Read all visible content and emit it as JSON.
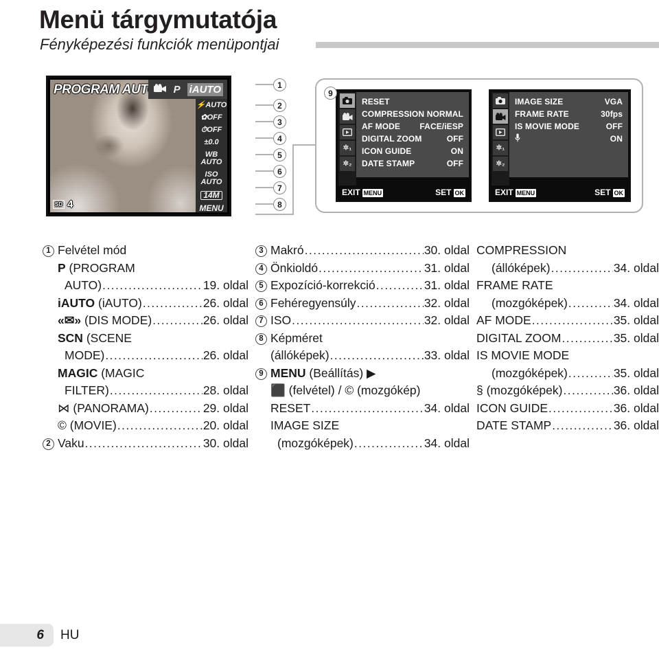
{
  "page": {
    "title": "Menü tárgymutatója",
    "subtitle": "Fényképezési funkciók menüpontjai",
    "footer_page_number": "6",
    "footer_language": "HU"
  },
  "lcd_preview": {
    "mode_banner": "PROGRAM AUTO",
    "topbar": [
      {
        "icon": "movie-icon",
        "label": "©©"
      },
      {
        "icon": "program-p-icon",
        "label": "P"
      },
      {
        "icon": "iauto-icon",
        "label": "iAUTO",
        "active": true
      }
    ],
    "side_items": [
      {
        "icon": "flash-icon",
        "label": "AUTO",
        "callout": "2"
      },
      {
        "icon": "macro-icon",
        "label": "OFF",
        "callout": "3"
      },
      {
        "icon": "selftimer-icon",
        "label": "OFF",
        "callout": "4"
      },
      {
        "icon": "exposure-comp-icon",
        "label": "±0.0",
        "callout": "5"
      },
      {
        "icon": "white-balance-icon",
        "label": "WB\nAUTO",
        "callout": "6"
      },
      {
        "icon": "iso-icon",
        "label": "ISO\nAUTO",
        "callout": "7"
      },
      {
        "icon": "image-size-icon",
        "label": "14M",
        "callout": "8"
      },
      {
        "icon": "menu-icon",
        "label": "MENU",
        "callout": ""
      }
    ],
    "card_label": "SD",
    "shots_remaining": "4",
    "callout_top": "1"
  },
  "menu_screens": {
    "group_callout": "9",
    "screens": [
      {
        "name": "shooting-menu",
        "selected_tab": 0,
        "tabs": [
          "camera-icon",
          "movie-icon",
          "playback-icon",
          "wrench-1-icon",
          "wrench-2-icon"
        ],
        "rows": [
          {
            "label": "RESET",
            "value": ""
          },
          {
            "label": "COMPRESSION",
            "value": "NORMAL"
          },
          {
            "label": "AF MODE",
            "value": "FACE/iESP"
          },
          {
            "label": "DIGITAL ZOOM",
            "value": "OFF"
          },
          {
            "label": "ICON GUIDE",
            "value": "ON"
          },
          {
            "label": "DATE STAMP",
            "value": "OFF"
          }
        ],
        "exit_label": "EXIT",
        "exit_key": "MENU",
        "set_label": "SET",
        "set_key": "OK"
      },
      {
        "name": "movie-menu",
        "selected_tab": 1,
        "tabs": [
          "camera-icon",
          "movie-icon",
          "playback-icon",
          "wrench-1-icon",
          "wrench-2-icon"
        ],
        "rows": [
          {
            "label": "IMAGE SIZE",
            "value": "VGA"
          },
          {
            "label": "FRAME RATE",
            "value": "30fps"
          },
          {
            "label": "IS MOVIE MODE",
            "value": "OFF"
          },
          {
            "label": "§MIC",
            "value": "ON",
            "icon": "microphone-icon"
          }
        ],
        "exit_label": "EXIT",
        "exit_key": "MENU",
        "set_label": "SET",
        "set_key": "OK"
      }
    ]
  },
  "index": {
    "column1": [
      {
        "num": "1",
        "label": "Felvétel mód",
        "dots": false,
        "page": "",
        "indent": 0
      },
      {
        "num": "",
        "label": "P (PROGRAM",
        "bold_prefix": "P",
        "dots": false,
        "page": "",
        "indent": 1
      },
      {
        "num": "",
        "label": "AUTO)",
        "dots": true,
        "page": "19. oldal",
        "indent": 2
      },
      {
        "num": "",
        "label": "iAUTO (iAUTO)",
        "bold_prefix": "iAUTO",
        "dots": true,
        "page": "26. oldal",
        "indent": 1
      },
      {
        "num": "",
        "label": "«✉» (DIS MODE)",
        "bold_prefix": "«✉»",
        "dots": true,
        "page": "26. oldal",
        "indent": 1
      },
      {
        "num": "",
        "label": "SCN (SCENE",
        "bold_prefix": "SCN",
        "dots": false,
        "page": "",
        "indent": 1
      },
      {
        "num": "",
        "label": "MODE)",
        "dots": true,
        "page": "26. oldal",
        "indent": 2
      },
      {
        "num": "",
        "label": "MAGIC (MAGIC",
        "bold_prefix": "MAGIC",
        "dots": false,
        "page": "",
        "indent": 1
      },
      {
        "num": "",
        "label": "FILTER)",
        "dots": true,
        "page": "28. oldal",
        "indent": 2
      },
      {
        "num": "",
        "label": "⋈ (PANORAMA)",
        "dots": true,
        "page": "29. oldal",
        "indent": 1
      },
      {
        "num": "",
        "label": "© (MOVIE)",
        "dots": true,
        "page": "20. oldal",
        "indent": 1
      },
      {
        "num": "2",
        "label": "Vaku",
        "dots": true,
        "page": "30. oldal",
        "indent": 0
      }
    ],
    "column2": [
      {
        "num": "3",
        "label": "Makró",
        "dots": true,
        "page": "30. oldal",
        "indent": 0
      },
      {
        "num": "4",
        "label": "Önkioldó",
        "dots": true,
        "page": "31. oldal",
        "indent": 0
      },
      {
        "num": "5",
        "label": "Expozíció-korrekció",
        "dots": true,
        "page": "31. oldal",
        "indent": 0
      },
      {
        "num": "6",
        "label": "Fehéregyensúly",
        "dots": true,
        "page": "32. oldal",
        "indent": 0
      },
      {
        "num": "7",
        "label": "ISO",
        "dots": true,
        "page": "32. oldal",
        "indent": 0
      },
      {
        "num": "8",
        "label": "Képméret",
        "dots": false,
        "page": "",
        "indent": 0
      },
      {
        "num": "",
        "label": "(állóképek)",
        "dots": true,
        "page": "33. oldal",
        "indent": 1
      },
      {
        "num": "9",
        "label": "MENU (Beállítás) ▶",
        "bold_prefix": "MENU",
        "dots": false,
        "page": "",
        "indent": 0
      },
      {
        "num": "",
        "label": "⬛ (felvétel) / © (mozgókép)",
        "dots": false,
        "page": "",
        "indent": 1
      },
      {
        "num": "",
        "label": "RESET",
        "dots": true,
        "page": "34. oldal",
        "indent": 1
      },
      {
        "num": "",
        "label": "IMAGE SIZE",
        "dots": false,
        "page": "",
        "indent": 1
      },
      {
        "num": "",
        "label": "(mozgóképek)",
        "dots": true,
        "page": "34. oldal",
        "indent": 2
      }
    ],
    "column3": [
      {
        "num": "",
        "label": "COMPRESSION",
        "dots": false,
        "page": "",
        "indent": 0
      },
      {
        "num": "",
        "label": "(állóképek)",
        "dots": true,
        "page": "34. oldal",
        "indent": 1
      },
      {
        "num": "",
        "label": "FRAME RATE",
        "dots": false,
        "page": "",
        "indent": 0
      },
      {
        "num": "",
        "label": "(mozgóképek)",
        "dots": true,
        "page": "34. oldal",
        "indent": 1
      },
      {
        "num": "",
        "label": "AF MODE",
        "dots": true,
        "page": "35. oldal",
        "indent": 0
      },
      {
        "num": "",
        "label": "DIGITAL ZOOM",
        "dots": true,
        "page": "35. oldal",
        "indent": 0
      },
      {
        "num": "",
        "label": "IS MOVIE MODE",
        "dots": false,
        "page": "",
        "indent": 0
      },
      {
        "num": "",
        "label": "(mozgóképek)",
        "dots": true,
        "page": "35. oldal",
        "indent": 1
      },
      {
        "num": "",
        "label": "§ (mozgóképek)",
        "dots": true,
        "page": "36. oldal",
        "indent": 0
      },
      {
        "num": "",
        "label": "ICON GUIDE",
        "dots": true,
        "page": "36. oldal",
        "indent": 0
      },
      {
        "num": "",
        "label": "DATE STAMP",
        "dots": true,
        "page": "36. oldal",
        "indent": 0
      }
    ]
  },
  "colors": {
    "rule": "#c9c9c9",
    "lcd_body": "#4a4a4a",
    "lcd_frame": "#0c0c0c",
    "tab_selected": "#a9a9a9",
    "footer_tab": "#e6e6e6"
  }
}
